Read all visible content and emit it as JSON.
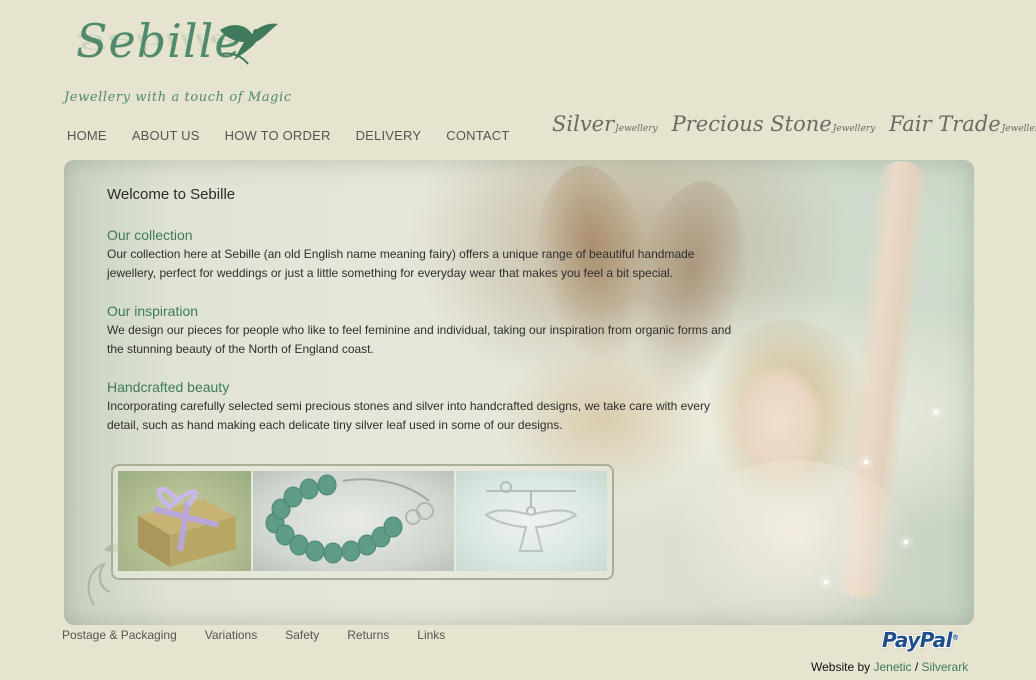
{
  "logo": {
    "wordmark": "Sebille",
    "tagline": "Jewellery with a touch of Magic"
  },
  "nav": {
    "items": [
      {
        "label": "HOME"
      },
      {
        "label": "ABOUT US"
      },
      {
        "label": "HOW TO ORDER"
      },
      {
        "label": "DELIVERY"
      },
      {
        "label": "CONTACT"
      }
    ]
  },
  "categories": [
    {
      "main": "Silver",
      "sub": "Jewellery"
    },
    {
      "main": "Precious Stone",
      "sub": "Jewellery"
    },
    {
      "main": "Fair Trade",
      "sub": "Jewellery"
    }
  ],
  "content": {
    "welcome": "Welcome to Sebille",
    "sections": [
      {
        "heading": "Our collection",
        "body": "Our collection here at Sebille (an old English name meaning fairy) offers a unique range of beautiful handmade jewellery, perfect for weddings or just a little something for everyday wear that makes you feel a bit special."
      },
      {
        "heading": "Our inspiration",
        "body": "We design our pieces for people who like to feel feminine and individual, taking our inspiration from organic forms and the stunning beauty of the North of England coast."
      },
      {
        "heading": "Handcrafted beauty",
        "body": "Incorporating carefully selected semi precious stones and silver into handcrafted designs, we take care with every detail, such as hand making each delicate tiny silver leaf used in some of our designs."
      }
    ]
  },
  "gallery": {
    "items": [
      {
        "subject": "gift-box-with-ribbon"
      },
      {
        "subject": "green-bead-necklace"
      },
      {
        "subject": "silver-fairy-pendant"
      }
    ]
  },
  "footer": {
    "links": [
      {
        "label": "Postage & Packaging"
      },
      {
        "label": "Variations"
      },
      {
        "label": "Safety"
      },
      {
        "label": "Returns"
      },
      {
        "label": "Links"
      }
    ],
    "paypal": "PayPal",
    "paypal_mark": "®",
    "credit_prefix": "Website by",
    "credit_1": "Jenetic",
    "credit_sep": "/",
    "credit_2": "Silverark"
  },
  "colors": {
    "background": "#e6e3cf",
    "accent_green": "#3f7a5c",
    "logo_green": "#4f8a6c",
    "paypal_blue": "#1f4d8c"
  }
}
